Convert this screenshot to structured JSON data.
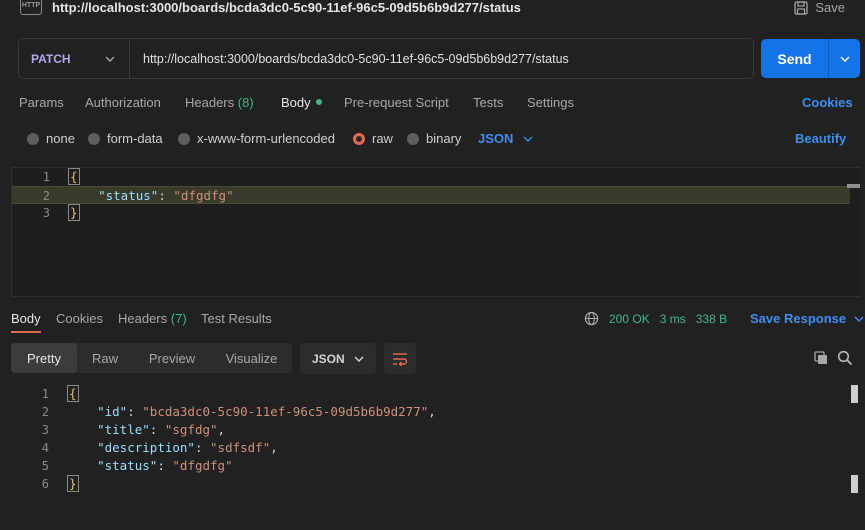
{
  "header": {
    "icon": "HTTP",
    "title": "http://localhost:3000/boards/bcda3dc0-5c90-11ef-96c5-09d5b6b9d277/status",
    "save_label": "Save"
  },
  "request": {
    "method": "PATCH",
    "url": "http://localhost:3000/boards/bcda3dc0-5c90-11ef-96c5-09d5b6b9d277/status",
    "send_label": "Send"
  },
  "request_tabs": {
    "params": "Params",
    "authorization": "Authorization",
    "headers": "Headers",
    "headers_count": "(8)",
    "body": "Body",
    "pre_request": "Pre-request Script",
    "tests": "Tests",
    "settings": "Settings",
    "cookies": "Cookies"
  },
  "body_options": {
    "none": "none",
    "form_data": "form-data",
    "urlencoded": "x-www-form-urlencoded",
    "raw": "raw",
    "binary": "binary",
    "format": "JSON",
    "beautify": "Beautify",
    "selected": "raw"
  },
  "request_body": {
    "line_numbers": [
      "1",
      "2",
      "3"
    ],
    "open_brace": "{",
    "key": "\"status\"",
    "colon": ": ",
    "value": "\"dfgdfg\"",
    "close_brace": "}"
  },
  "response_tabs": {
    "body": "Body",
    "cookies": "Cookies",
    "headers": "Headers",
    "headers_count": "(7)",
    "test_results": "Test Results"
  },
  "response_status": {
    "status": "200 OK",
    "time": "3 ms",
    "size": "338 B",
    "save_response": "Save Response"
  },
  "response_view": {
    "pretty": "Pretty",
    "raw": "Raw",
    "preview": "Preview",
    "visualize": "Visualize",
    "format": "JSON"
  },
  "response_body": {
    "line_numbers": [
      "1",
      "2",
      "3",
      "4",
      "5",
      "6"
    ],
    "open_brace": "{",
    "close_brace": "}",
    "fields": [
      {
        "key": "\"id\"",
        "value": "\"bcda3dc0-5c90-11ef-96c5-09d5b6b9d277\"",
        "comma": ","
      },
      {
        "key": "\"title\"",
        "value": "\"sgfdg\"",
        "comma": ","
      },
      {
        "key": "\"description\"",
        "value": "\"sdfsdf\"",
        "comma": ","
      },
      {
        "key": "\"status\"",
        "value": "\"dfgdfg\"",
        "comma": ""
      }
    ]
  },
  "colors": {
    "accent_blue": "#1473e6",
    "link_blue": "#3d8ef0",
    "success_green": "#41b883",
    "radio_active": "#e06c4f"
  }
}
